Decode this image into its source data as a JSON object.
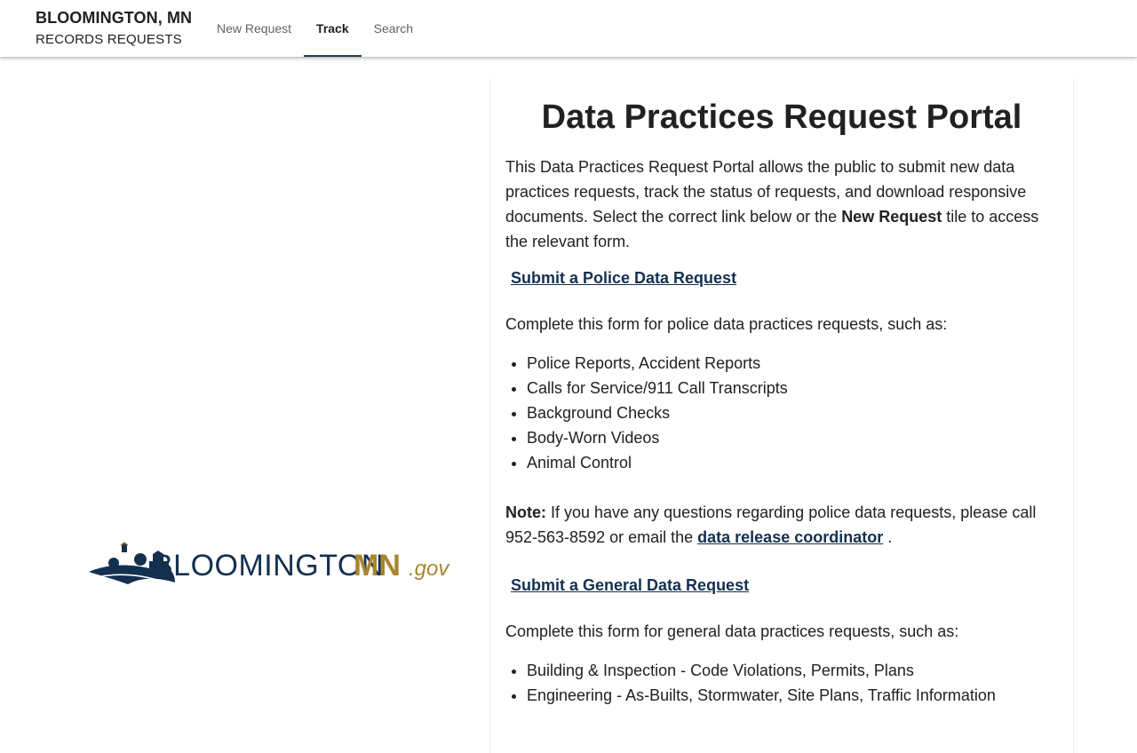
{
  "header": {
    "city": "BLOOMINGTON, MN",
    "subtitle": "RECORDS REQUESTS",
    "tabs": [
      {
        "label": "New Request",
        "active": false
      },
      {
        "label": "Track",
        "active": true
      },
      {
        "label": "Search",
        "active": false
      }
    ],
    "accent_color": "#1f3a5a"
  },
  "logo": {
    "wordmark_a": "BLOOMINGTON",
    "wordmark_b": "MN",
    "wordmark_c": ".gov",
    "colors": {
      "navy": "#14304f",
      "gold": "#a8862f"
    }
  },
  "main": {
    "title": "Data Practices Request Portal",
    "intro_before": "This Data Practices Request Portal allows the public to submit new data practices requests, track the status of requests, and download responsive documents. Select the correct link below or the ",
    "intro_bold": "New Request",
    "intro_after": " tile to access the relevant form.",
    "police": {
      "link": "Submit a Police Data Request",
      "description": "Complete this form for police data practices requests, such as:",
      "items": [
        "Police Reports, Accident Reports",
        "Calls for Service/911 Call Transcripts",
        "Background Checks",
        "Body-Worn Videos",
        "Animal Control"
      ],
      "note_label": "Note:",
      "note_text": " If you have any questions regarding police data requests, please call 952-563-8592 or email the ",
      "note_link": "data release coordinator",
      "note_end": " ."
    },
    "general": {
      "link": "Submit a General Data Request",
      "description": "Complete this form for general data practices requests, such as:",
      "items": [
        "Building & Inspection - Code Violations, Permits, Plans",
        "Engineering - As-Builts, Stormwater, Site Plans, Traffic Information"
      ]
    }
  }
}
